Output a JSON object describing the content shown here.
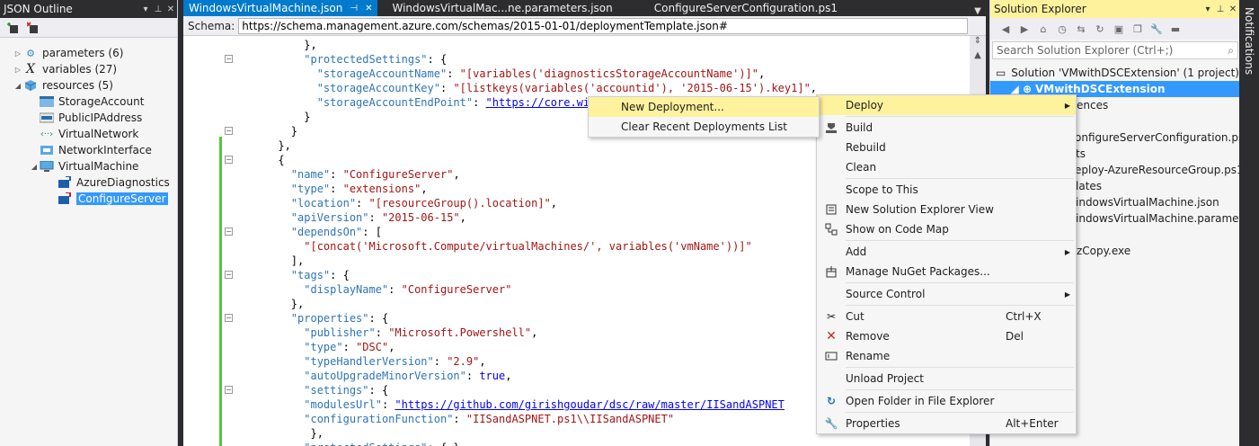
{
  "outline": {
    "title": "JSON Outline",
    "nodes": [
      {
        "label": "parameters (6)",
        "icon": "gear-icon"
      },
      {
        "label": "variables (27)",
        "icon": "variable-x-icon"
      },
      {
        "label": "resources (5)",
        "icon": "cube-icon"
      },
      {
        "label": "StorageAccount",
        "icon": "storage-icon"
      },
      {
        "label": "PublicIPAddress",
        "icon": "ip-address-icon"
      },
      {
        "label": "VirtualNetwork",
        "icon": "network-icon"
      },
      {
        "label": "NetworkInterface",
        "icon": "nic-icon"
      },
      {
        "label": "VirtualMachine",
        "icon": "vm-icon"
      },
      {
        "label": "AzureDiagnostics",
        "icon": "extension-icon"
      },
      {
        "label": "ConfigureServer",
        "icon": "extension-icon"
      }
    ]
  },
  "editor": {
    "tabs": [
      {
        "label": "WindowsVirtualMachine.json"
      },
      {
        "label": "WindowsVirtualMac...ne.parameters.json"
      },
      {
        "label": "ConfigureServerConfiguration.ps1"
      }
    ],
    "schema_label": "Schema:",
    "schema_value": "https://schema.management.azure.com/schemas/2015-01-01/deploymentTemplate.json#"
  },
  "solution": {
    "title": "Solution Explorer",
    "search_placeholder": "Search Solution Explorer (Ctrl+;)",
    "items": [
      {
        "label": "Solution 'VMwithDSCExtension' (1 project)"
      },
      {
        "label": "VMwithDSCExtension"
      },
      {
        "label": "ences"
      },
      {
        "label": "onfigureServerConfiguration.ps1"
      },
      {
        "label": "ts"
      },
      {
        "label": "eploy-AzureResourceGroup.ps1"
      },
      {
        "label": "lates"
      },
      {
        "label": "indowsVirtualMachine.json"
      },
      {
        "label": "indowsVirtualMachine.parameters"
      },
      {
        "label": "zCopy.exe"
      }
    ]
  },
  "notifications_label": "Notifications",
  "context_menu": {
    "items": [
      {
        "label": "Deploy",
        "icon": "",
        "shortcut": "",
        "submenu": true
      },
      {
        "label": "Build",
        "icon": "build-icon",
        "shortcut": ""
      },
      {
        "label": "Rebuild",
        "icon": "",
        "shortcut": ""
      },
      {
        "label": "Clean",
        "icon": "",
        "shortcut": ""
      },
      {
        "label": "Scope to This",
        "icon": "",
        "shortcut": ""
      },
      {
        "label": "New Solution Explorer View",
        "icon": "new-view-icon",
        "shortcut": ""
      },
      {
        "label": "Show on Code Map",
        "icon": "code-map-icon",
        "shortcut": ""
      },
      {
        "label": "Add",
        "icon": "",
        "shortcut": "",
        "submenu": true
      },
      {
        "label": "Manage NuGet Packages...",
        "icon": "nuget-icon",
        "shortcut": ""
      },
      {
        "label": "Source Control",
        "icon": "",
        "shortcut": "",
        "submenu": true
      },
      {
        "label": "Cut",
        "icon": "scissors-icon",
        "shortcut": "Ctrl+X"
      },
      {
        "label": "Remove",
        "icon": "remove-x-icon",
        "shortcut": "Del"
      },
      {
        "label": "Rename",
        "icon": "rename-icon",
        "shortcut": ""
      },
      {
        "label": "Unload Project",
        "icon": "",
        "shortcut": ""
      },
      {
        "label": "Open Folder in File Explorer",
        "icon": "refresh-arrow-icon",
        "shortcut": ""
      },
      {
        "label": "Properties",
        "icon": "wrench-icon",
        "shortcut": "Alt+Enter"
      }
    ]
  },
  "deploy_submenu": {
    "items": [
      {
        "label": "New Deployment..."
      },
      {
        "label": "Clear Recent Deployments List"
      }
    ]
  },
  "colors": {
    "accent": "#007acc",
    "selection": "#3399ff",
    "highlight": "#fff29d",
    "string": "#a31515",
    "key": "#2e75b6",
    "link": "#0000ff"
  }
}
